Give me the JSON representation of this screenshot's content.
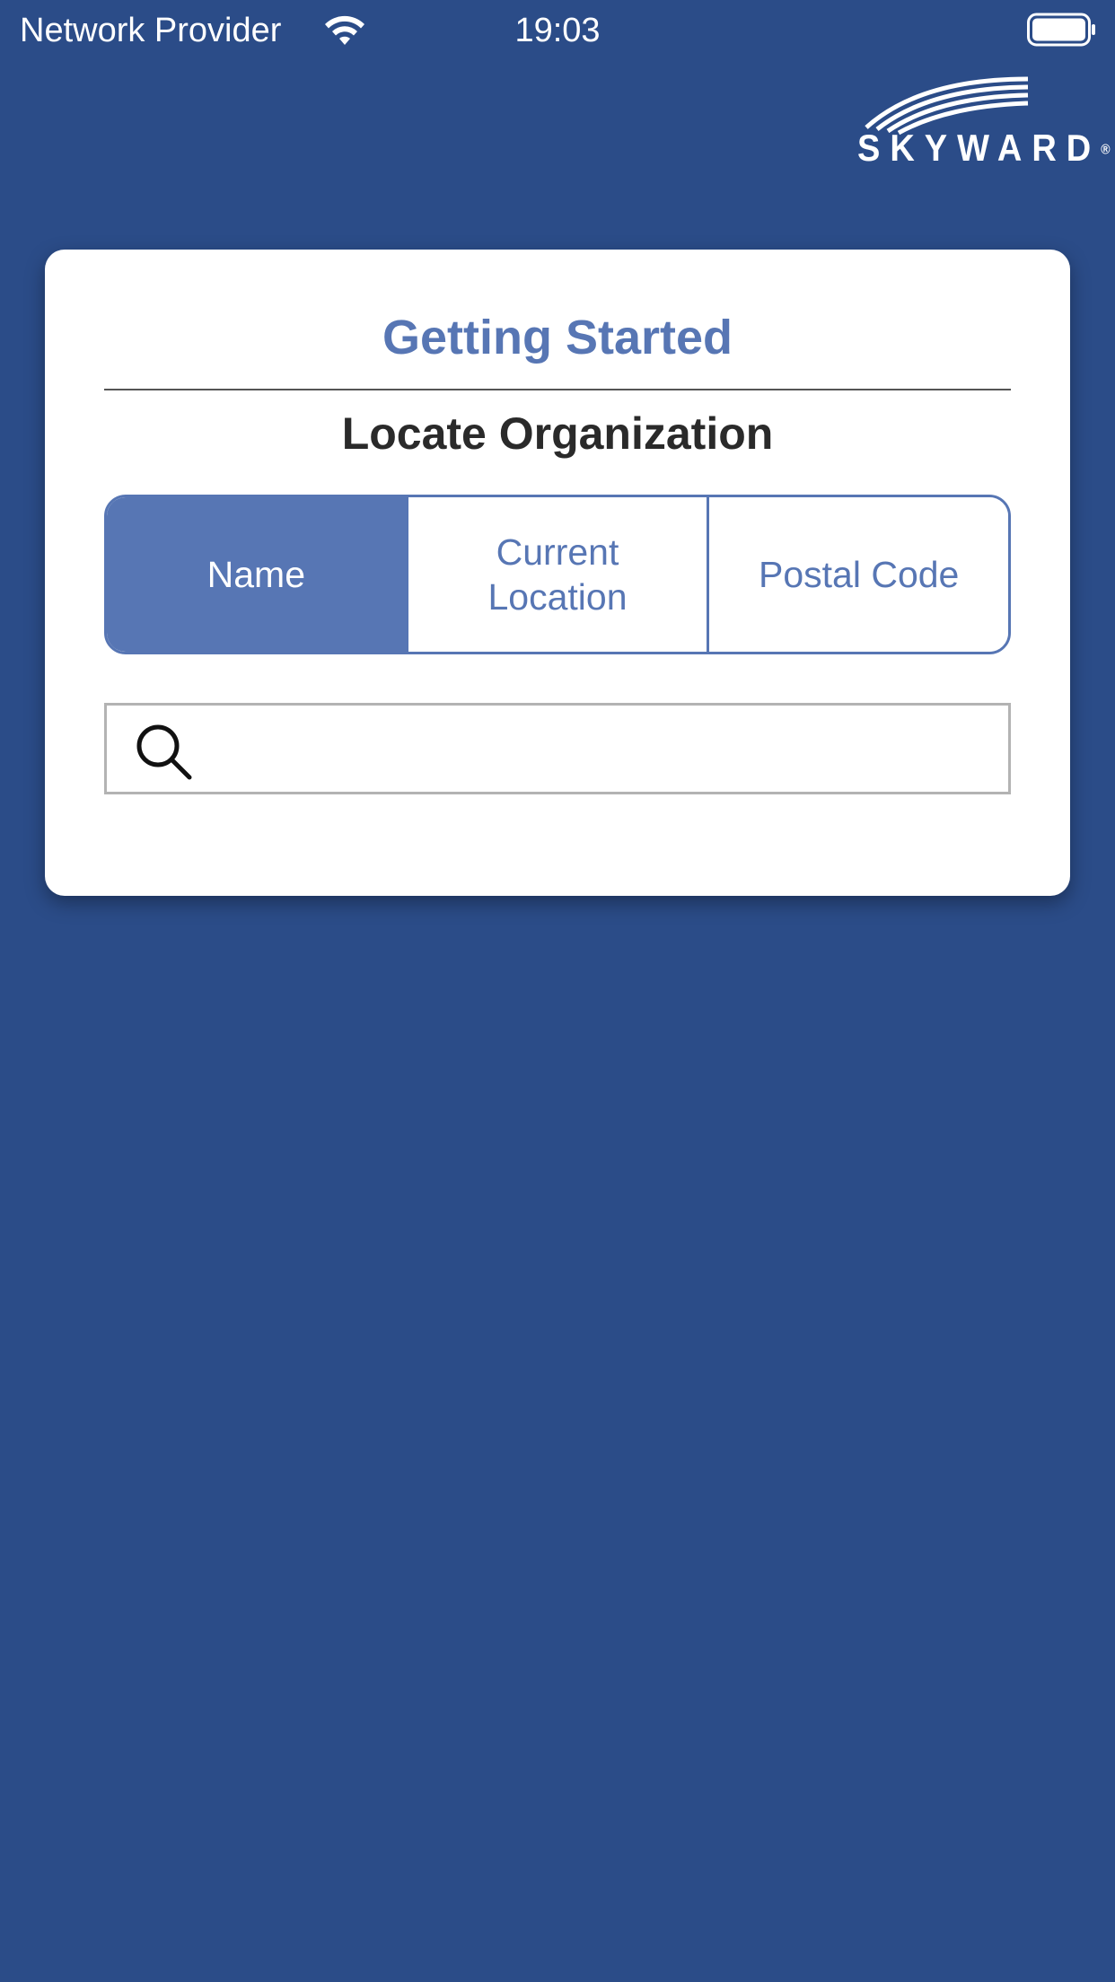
{
  "status_bar": {
    "carrier": "Network Provider",
    "time": "19:03",
    "wifi_icon": "wifi-icon",
    "battery_icon": "battery-icon"
  },
  "logo": {
    "text": "SKYWARD",
    "mark": "®"
  },
  "card": {
    "title": "Getting Started",
    "subtitle": "Locate Organization",
    "tabs": [
      {
        "label": "Name",
        "active": true
      },
      {
        "label": "Current Location",
        "active": false
      },
      {
        "label": "Postal Code",
        "active": false
      }
    ],
    "search": {
      "icon": "search-icon",
      "value": "",
      "placeholder": ""
    }
  },
  "colors": {
    "background": "#2b4c88",
    "accent": "#5776b4",
    "card": "#ffffff",
    "divider": "#555555",
    "search_border": "#b3b3b3"
  }
}
